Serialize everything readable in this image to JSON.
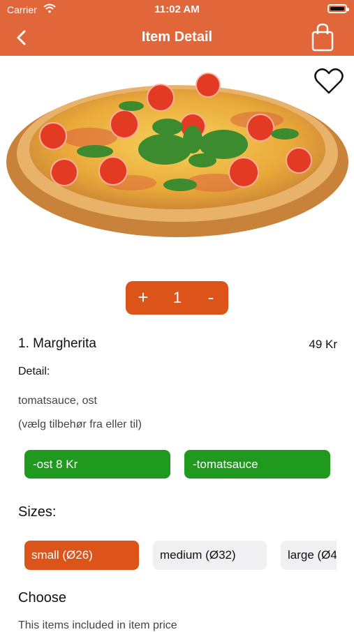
{
  "status": {
    "carrier": "Carrier",
    "time": "11:02 AM"
  },
  "nav": {
    "title": "Item Detail",
    "back_icon": "chevron-left-icon",
    "cart_icon": "shopping-bag-icon"
  },
  "hero": {
    "favorite_icon": "heart-icon"
  },
  "quantity": {
    "plus": "+",
    "value": "1",
    "minus": "-"
  },
  "item": {
    "name": "1. Margherita",
    "price": "49 Kr",
    "detail_label": "Detail:",
    "ingredients": "tomatsauce, ost",
    "note": "(vælg tilbehør fra eller til)"
  },
  "addons": [
    "-ost 8 Kr",
    "-tomatsauce"
  ],
  "sizes": {
    "title": "Sizes:",
    "options": [
      "small  (Ø26)",
      "medium  (Ø32)",
      "large (Ø4"
    ],
    "selected": "small  (Ø26)"
  },
  "choose": {
    "title": "Choose",
    "subtitle": "This items included in item price"
  },
  "colors": {
    "accent": "#e1663a",
    "button": "#dc5419",
    "addon": "#1f9a1f",
    "chip": "#f0f0f3"
  }
}
